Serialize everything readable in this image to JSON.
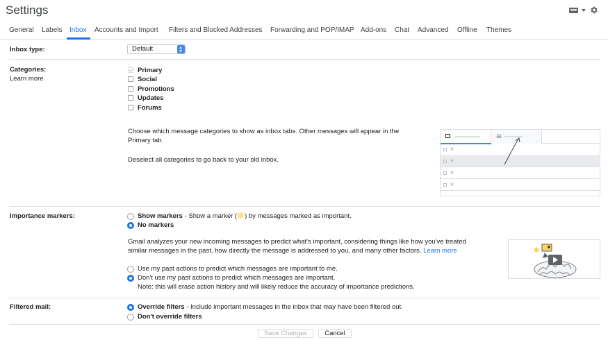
{
  "page": {
    "title": "Settings"
  },
  "tabs": [
    {
      "label": "General"
    },
    {
      "label": "Labels"
    },
    {
      "label": "Inbox"
    },
    {
      "label": "Accounts and Import"
    },
    {
      "label": "Filters and Blocked Addresses"
    },
    {
      "label": "Forwarding and POP/IMAP"
    },
    {
      "label": "Add-ons"
    },
    {
      "label": "Chat"
    },
    {
      "label": "Advanced"
    },
    {
      "label": "Offline"
    },
    {
      "label": "Themes"
    }
  ],
  "active_tab": "Inbox",
  "inbox_type": {
    "label": "Inbox type:",
    "selected": "Default"
  },
  "categories": {
    "label": "Categories:",
    "learn_more": "Learn more",
    "items": [
      {
        "label": "Primary",
        "checked": true,
        "disabled": true
      },
      {
        "label": "Social",
        "checked": false
      },
      {
        "label": "Promotions",
        "checked": false
      },
      {
        "label": "Updates",
        "checked": false
      },
      {
        "label": "Forums",
        "checked": false
      }
    ],
    "description_line1": "Choose which message categories to show as inbox tabs. Other messages will appear in the",
    "description_line2": "Primary tab.",
    "deselect_note": "Deselect all categories to go back to your old inbox."
  },
  "importance": {
    "label": "Importance markers:",
    "show_markers_label": "Show markers",
    "show_markers_desc_pre": " - Show a marker (",
    "show_markers_desc_post": ") by messages marked as important.",
    "no_markers_label": "No markers",
    "selected": "No markers",
    "analysis_line1": "Gmail analyzes your new incoming messages to predict what's important, considering things like how you've treated",
    "analysis_line2": "similar messages in the past, how directly the message is addressed to you, and many other factors.",
    "learn_more": "Learn more",
    "use_actions": "Use my past actions to predict which messages are important to me.",
    "dont_use_actions": "Don't use my past actions to predict which messages are important.",
    "dont_use_note": "Note: this will erase action history and will likely reduce the accuracy of importance predictions.",
    "actions_selected": "Don't use my past actions to predict which messages are important."
  },
  "filtered_mail": {
    "label": "Filtered mail:",
    "override_label": "Override filters",
    "override_desc": " - Include important messages in the inbox that may have been filtered out.",
    "dont_override_label": "Don't override filters",
    "selected": "Override filters"
  },
  "footer": {
    "save_label": "Save Changes",
    "cancel_label": "Cancel"
  },
  "colors": {
    "accent": "#1a73e8",
    "marker": "#fdd663",
    "divider": "#e0e0e0"
  },
  "icons": [
    "keyboard-icon",
    "chevron-down-icon",
    "gear-icon",
    "inbox-icon",
    "people-icon",
    "star-icon",
    "importance-marker-icon",
    "play-icon"
  ]
}
